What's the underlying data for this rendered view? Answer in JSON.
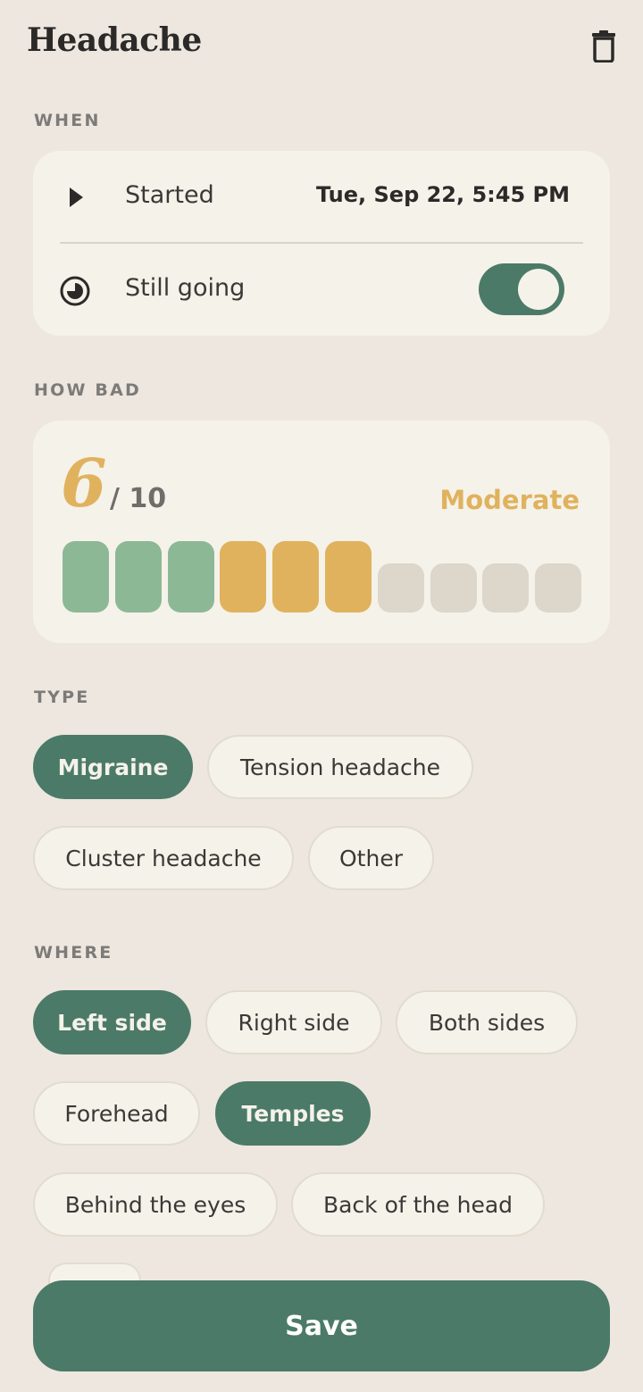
{
  "header": {
    "title": "Headache",
    "delete_icon": "trash-icon"
  },
  "when": {
    "label": "WHEN",
    "started": {
      "icon": "play-icon",
      "label": "Started",
      "value": "Tue, Sep 22, 5:45 PM"
    },
    "still_going": {
      "icon": "half-moon-clock-icon",
      "label": "Still going",
      "on": true
    }
  },
  "how_bad": {
    "label": "HOW BAD",
    "score": "6",
    "out_of": "/ 10",
    "severity": "Moderate",
    "level": 6,
    "max": 10,
    "colors": {
      "low": "#8DB896",
      "moderate": "#E0B25D",
      "empty": "#DCD6CB"
    }
  },
  "type": {
    "label": "TYPE",
    "options": [
      {
        "label": "Migraine",
        "selected": true
      },
      {
        "label": "Tension headache",
        "selected": false
      },
      {
        "label": "Cluster headache",
        "selected": false
      },
      {
        "label": "Other",
        "selected": false
      }
    ]
  },
  "where": {
    "label": "WHERE",
    "options": [
      {
        "label": "Left side",
        "selected": true
      },
      {
        "label": "Right side",
        "selected": false
      },
      {
        "label": "Both sides",
        "selected": false
      },
      {
        "label": "Forehead",
        "selected": false
      },
      {
        "label": "Temples",
        "selected": true
      },
      {
        "label": "Behind the eyes",
        "selected": false
      },
      {
        "label": "Back of the head",
        "selected": false
      }
    ]
  },
  "save_label": "Save",
  "colors": {
    "accent": "#4B7A68",
    "background": "#EEE7DF",
    "card": "#F5F2EA"
  }
}
